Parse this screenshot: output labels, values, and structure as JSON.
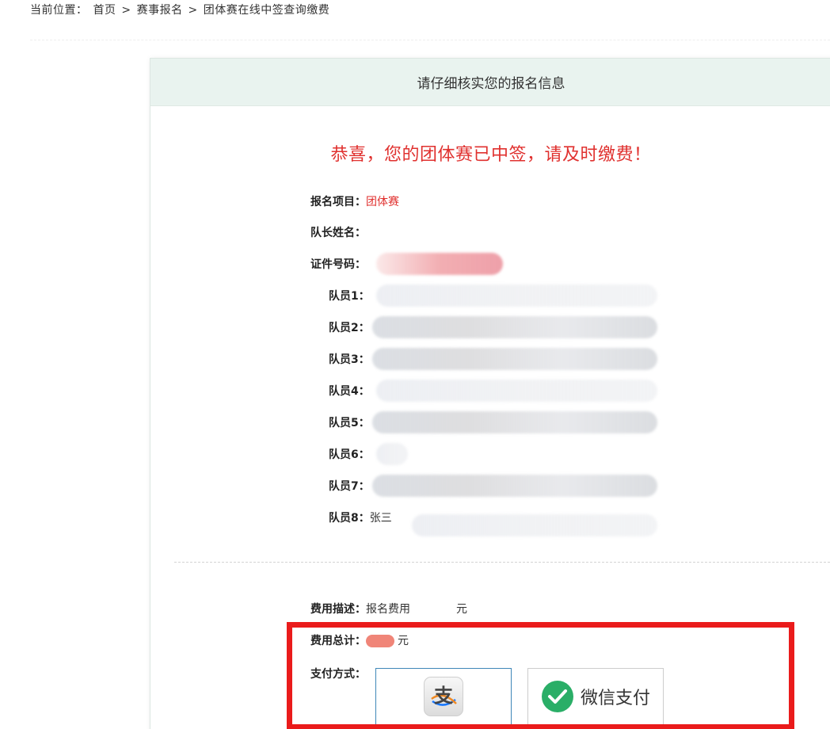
{
  "breadcrumb": {
    "prefix": "当前位置：",
    "items": [
      "首页",
      "赛事报名",
      "团体赛在线中签查询缴费"
    ],
    "separator": ">"
  },
  "panel": {
    "title": "请仔细核实您的报名信息",
    "success_message": "恭喜，您的团体赛已中签，请及时缴费！"
  },
  "info": {
    "project_label": "报名项目：",
    "project_value": "团体赛",
    "captain_label": "队长姓名：",
    "id_label": "证件号码：",
    "members": [
      {
        "label": "队员1："
      },
      {
        "label": "队员2："
      },
      {
        "label": "队员3："
      },
      {
        "label": "队员4："
      },
      {
        "label": "队员5："
      },
      {
        "label": "队员6："
      },
      {
        "label": "队员7："
      },
      {
        "label": "队员8：",
        "value": "张三"
      }
    ]
  },
  "fee": {
    "desc_label": "费用描述：",
    "desc_value": "报名费用",
    "desc_unit": "元",
    "total_label": "费用总计：",
    "total_unit": "元"
  },
  "payment": {
    "label": "支付方式：",
    "alipay_glyph": "支",
    "wechat_label": "微信支付"
  },
  "colors": {
    "accent_red": "#e0312f",
    "header_bg": "#e9f3ef",
    "highlight": "#ea1b1b",
    "wechat_green": "#2aae67",
    "alipay_blue": "#1677ff"
  },
  "icons": {
    "alipay": "alipay-icon",
    "wechat": "wechat-icon"
  }
}
